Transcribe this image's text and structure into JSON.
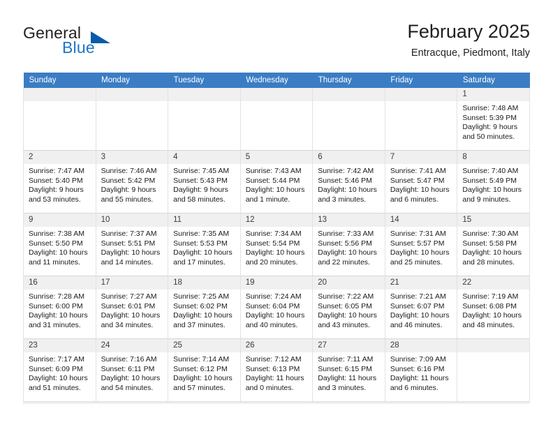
{
  "brand": {
    "word_general": "General",
    "word_blue": "Blue",
    "triangle_color": "#0a5ca8",
    "blue_color": "#2176c7"
  },
  "header": {
    "title": "February 2025",
    "location": "Entracque, Piedmont, Italy"
  },
  "theme": {
    "header_row_bg": "#3a7dc4",
    "daynum_bg": "#f0f0f0",
    "grid_line": "#d7d7d7"
  },
  "weekday_headers": [
    "Sunday",
    "Monday",
    "Tuesday",
    "Wednesday",
    "Thursday",
    "Friday",
    "Saturday"
  ],
  "weeks": [
    [
      {
        "empty": true,
        "day": ""
      },
      {
        "empty": true,
        "day": ""
      },
      {
        "empty": true,
        "day": ""
      },
      {
        "empty": true,
        "day": ""
      },
      {
        "empty": true,
        "day": ""
      },
      {
        "empty": true,
        "day": ""
      },
      {
        "empty": false,
        "day": "1",
        "sunrise": "Sunrise: 7:48 AM",
        "sunset": "Sunset: 5:39 PM",
        "daylight1": "Daylight: 9 hours",
        "daylight2": "and 50 minutes."
      }
    ],
    [
      {
        "empty": false,
        "day": "2",
        "sunrise": "Sunrise: 7:47 AM",
        "sunset": "Sunset: 5:40 PM",
        "daylight1": "Daylight: 9 hours",
        "daylight2": "and 53 minutes."
      },
      {
        "empty": false,
        "day": "3",
        "sunrise": "Sunrise: 7:46 AM",
        "sunset": "Sunset: 5:42 PM",
        "daylight1": "Daylight: 9 hours",
        "daylight2": "and 55 minutes."
      },
      {
        "empty": false,
        "day": "4",
        "sunrise": "Sunrise: 7:45 AM",
        "sunset": "Sunset: 5:43 PM",
        "daylight1": "Daylight: 9 hours",
        "daylight2": "and 58 minutes."
      },
      {
        "empty": false,
        "day": "5",
        "sunrise": "Sunrise: 7:43 AM",
        "sunset": "Sunset: 5:44 PM",
        "daylight1": "Daylight: 10 hours",
        "daylight2": "and 1 minute."
      },
      {
        "empty": false,
        "day": "6",
        "sunrise": "Sunrise: 7:42 AM",
        "sunset": "Sunset: 5:46 PM",
        "daylight1": "Daylight: 10 hours",
        "daylight2": "and 3 minutes."
      },
      {
        "empty": false,
        "day": "7",
        "sunrise": "Sunrise: 7:41 AM",
        "sunset": "Sunset: 5:47 PM",
        "daylight1": "Daylight: 10 hours",
        "daylight2": "and 6 minutes."
      },
      {
        "empty": false,
        "day": "8",
        "sunrise": "Sunrise: 7:40 AM",
        "sunset": "Sunset: 5:49 PM",
        "daylight1": "Daylight: 10 hours",
        "daylight2": "and 9 minutes."
      }
    ],
    [
      {
        "empty": false,
        "day": "9",
        "sunrise": "Sunrise: 7:38 AM",
        "sunset": "Sunset: 5:50 PM",
        "daylight1": "Daylight: 10 hours",
        "daylight2": "and 11 minutes."
      },
      {
        "empty": false,
        "day": "10",
        "sunrise": "Sunrise: 7:37 AM",
        "sunset": "Sunset: 5:51 PM",
        "daylight1": "Daylight: 10 hours",
        "daylight2": "and 14 minutes."
      },
      {
        "empty": false,
        "day": "11",
        "sunrise": "Sunrise: 7:35 AM",
        "sunset": "Sunset: 5:53 PM",
        "daylight1": "Daylight: 10 hours",
        "daylight2": "and 17 minutes."
      },
      {
        "empty": false,
        "day": "12",
        "sunrise": "Sunrise: 7:34 AM",
        "sunset": "Sunset: 5:54 PM",
        "daylight1": "Daylight: 10 hours",
        "daylight2": "and 20 minutes."
      },
      {
        "empty": false,
        "day": "13",
        "sunrise": "Sunrise: 7:33 AM",
        "sunset": "Sunset: 5:56 PM",
        "daylight1": "Daylight: 10 hours",
        "daylight2": "and 22 minutes."
      },
      {
        "empty": false,
        "day": "14",
        "sunrise": "Sunrise: 7:31 AM",
        "sunset": "Sunset: 5:57 PM",
        "daylight1": "Daylight: 10 hours",
        "daylight2": "and 25 minutes."
      },
      {
        "empty": false,
        "day": "15",
        "sunrise": "Sunrise: 7:30 AM",
        "sunset": "Sunset: 5:58 PM",
        "daylight1": "Daylight: 10 hours",
        "daylight2": "and 28 minutes."
      }
    ],
    [
      {
        "empty": false,
        "day": "16",
        "sunrise": "Sunrise: 7:28 AM",
        "sunset": "Sunset: 6:00 PM",
        "daylight1": "Daylight: 10 hours",
        "daylight2": "and 31 minutes."
      },
      {
        "empty": false,
        "day": "17",
        "sunrise": "Sunrise: 7:27 AM",
        "sunset": "Sunset: 6:01 PM",
        "daylight1": "Daylight: 10 hours",
        "daylight2": "and 34 minutes."
      },
      {
        "empty": false,
        "day": "18",
        "sunrise": "Sunrise: 7:25 AM",
        "sunset": "Sunset: 6:02 PM",
        "daylight1": "Daylight: 10 hours",
        "daylight2": "and 37 minutes."
      },
      {
        "empty": false,
        "day": "19",
        "sunrise": "Sunrise: 7:24 AM",
        "sunset": "Sunset: 6:04 PM",
        "daylight1": "Daylight: 10 hours",
        "daylight2": "and 40 minutes."
      },
      {
        "empty": false,
        "day": "20",
        "sunrise": "Sunrise: 7:22 AM",
        "sunset": "Sunset: 6:05 PM",
        "daylight1": "Daylight: 10 hours",
        "daylight2": "and 43 minutes."
      },
      {
        "empty": false,
        "day": "21",
        "sunrise": "Sunrise: 7:21 AM",
        "sunset": "Sunset: 6:07 PM",
        "daylight1": "Daylight: 10 hours",
        "daylight2": "and 46 minutes."
      },
      {
        "empty": false,
        "day": "22",
        "sunrise": "Sunrise: 7:19 AM",
        "sunset": "Sunset: 6:08 PM",
        "daylight1": "Daylight: 10 hours",
        "daylight2": "and 48 minutes."
      }
    ],
    [
      {
        "empty": false,
        "day": "23",
        "sunrise": "Sunrise: 7:17 AM",
        "sunset": "Sunset: 6:09 PM",
        "daylight1": "Daylight: 10 hours",
        "daylight2": "and 51 minutes."
      },
      {
        "empty": false,
        "day": "24",
        "sunrise": "Sunrise: 7:16 AM",
        "sunset": "Sunset: 6:11 PM",
        "daylight1": "Daylight: 10 hours",
        "daylight2": "and 54 minutes."
      },
      {
        "empty": false,
        "day": "25",
        "sunrise": "Sunrise: 7:14 AM",
        "sunset": "Sunset: 6:12 PM",
        "daylight1": "Daylight: 10 hours",
        "daylight2": "and 57 minutes."
      },
      {
        "empty": false,
        "day": "26",
        "sunrise": "Sunrise: 7:12 AM",
        "sunset": "Sunset: 6:13 PM",
        "daylight1": "Daylight: 11 hours",
        "daylight2": "and 0 minutes."
      },
      {
        "empty": false,
        "day": "27",
        "sunrise": "Sunrise: 7:11 AM",
        "sunset": "Sunset: 6:15 PM",
        "daylight1": "Daylight: 11 hours",
        "daylight2": "and 3 minutes."
      },
      {
        "empty": false,
        "day": "28",
        "sunrise": "Sunrise: 7:09 AM",
        "sunset": "Sunset: 6:16 PM",
        "daylight1": "Daylight: 11 hours",
        "daylight2": "and 6 minutes."
      },
      {
        "empty": true,
        "day": ""
      }
    ]
  ]
}
